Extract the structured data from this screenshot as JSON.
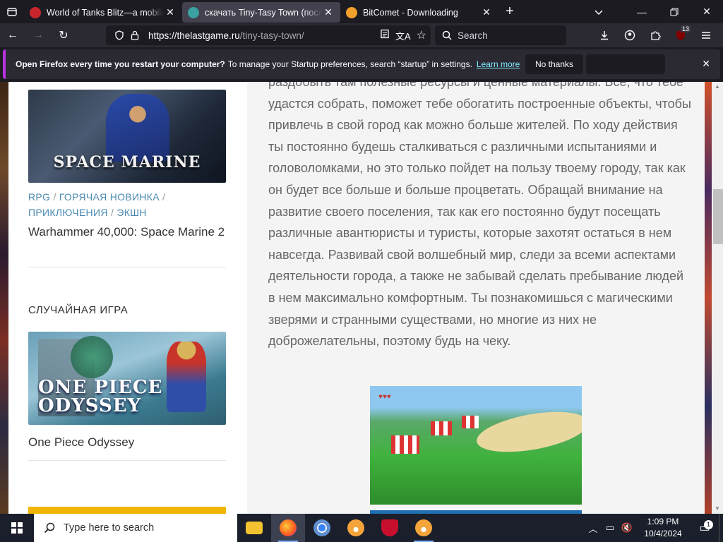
{
  "tabs": [
    {
      "title": "World of Tanks Blitz—a mobile tank game",
      "favicon_color": "#c8262c",
      "active": false
    },
    {
      "title": "скачать Tiny-Tasy Town (последняя версия)",
      "favicon_color": "#3aa0a0",
      "active": true
    },
    {
      "title": "BitComet - Downloading",
      "favicon_color": "#f2a02a",
      "active": false
    }
  ],
  "nav": {
    "url_domain": "https://thelastgame.ru",
    "url_path": "/tiny-tasy-town/",
    "search_placeholder": "Search",
    "extension_badge": "13"
  },
  "notification": {
    "bold_text": "Open Firefox every time you restart your computer?",
    "message": "To manage your Startup preferences, search “startup” in settings.",
    "learn_more": "Learn more",
    "no_thanks": "No thanks"
  },
  "sidebar": {
    "card1": {
      "image_text": "SPACE MARINE",
      "tags": [
        "RPG",
        "ГОРЯЧАЯ НОВИНКА",
        "ПРИКЛЮЧЕНИЯ",
        "ЭКШН"
      ],
      "title": "Warhammer 40,000: Space Marine 2"
    },
    "random_section_title": "СЛУЧАЙНАЯ ИГРА",
    "card2": {
      "image_text_line1": "ONE PIECE",
      "image_text_line2": "ODYSSEY",
      "title": "One Piece Odyssey"
    }
  },
  "article": {
    "text": "раздобыть там полезные ресурсы и ценные материалы. Все, что тебе удастся собрать, поможет тебе обогатить построенные объекты, чтобы привлечь в свой город как можно больше жителей. По ходу действия ты постоянно будешь сталкиваться с различными испытаниями и головоломками, но это только пойдет на пользу твоему городу, так как он будет все больше и больше процветать. Обращай внимание на развитие своего поселения, так как его постоянно будут посещать различные авантюристы и туристы, которые захотят остаться в нем навсегда. Развивай свой волшебный мир, следи за всеми аспектами деятельности города, а также не забывай сделать пребывание людей в нем максимально комфортным. Ты познакомишься с магическими зверями и странными существами, но многие из них не доброжелательны, поэтому будь на чеку."
  },
  "taskbar": {
    "search_placeholder": "Type here to search",
    "apps": [
      {
        "name": "file-explorer",
        "color": "#f2c230",
        "active": false,
        "running": false
      },
      {
        "name": "firefox",
        "color": "#ff7b1a",
        "active": true,
        "running": true
      },
      {
        "name": "chrome",
        "color": "#3b82f6",
        "active": false,
        "running": false
      },
      {
        "name": "bitcomet",
        "color": "#f4a43a",
        "active": false,
        "running": false
      },
      {
        "name": "mcafee",
        "color": "#c8102e",
        "active": false,
        "running": false
      },
      {
        "name": "bitcomet-2",
        "color": "#f4a43a",
        "active": false,
        "running": true
      }
    ],
    "time": "1:09 PM",
    "date": "10/4/2024",
    "notification_count": "1"
  }
}
